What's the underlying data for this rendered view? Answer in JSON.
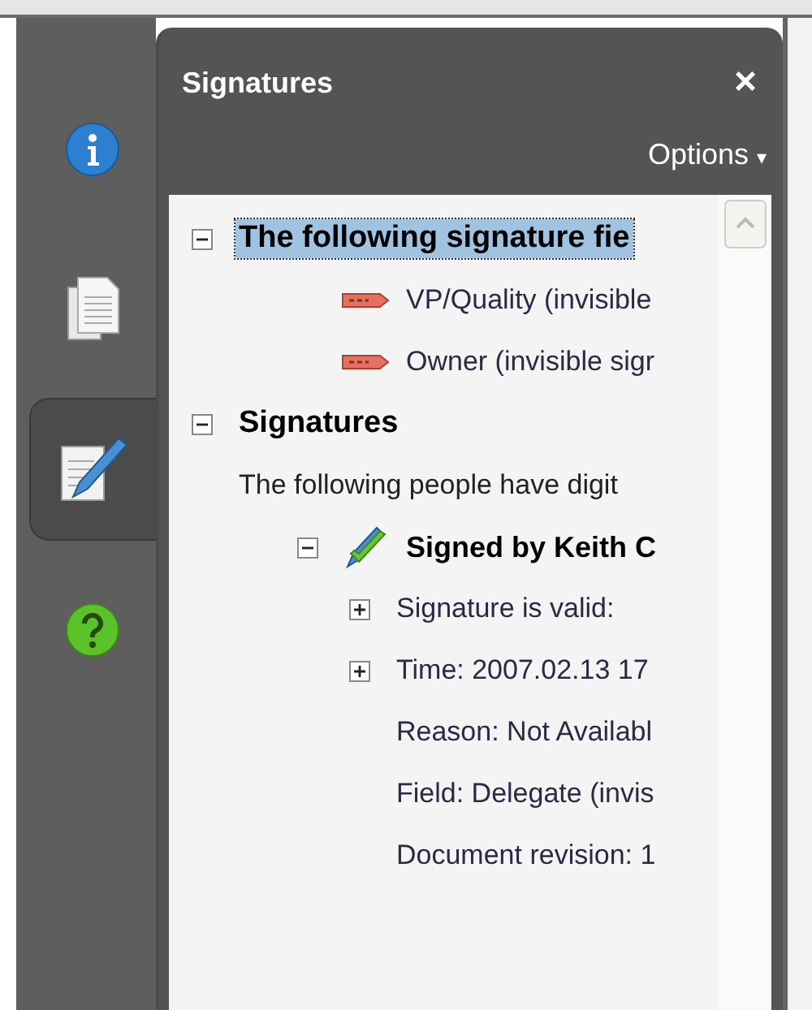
{
  "sidebar": {
    "tabs": [
      {
        "selected": false
      },
      {
        "selected": false
      },
      {
        "selected": true
      },
      {
        "selected": false
      }
    ]
  },
  "panel": {
    "title": "Signatures",
    "close": "×",
    "options": "Options",
    "options_caret": "▾"
  },
  "tree": [
    {
      "kind": "heading",
      "text": "The following signature fie",
      "expanded": true,
      "selected": true,
      "children": [
        {
          "kind": "field",
          "text": "VP/Quality (invisible",
          "selected": false
        },
        {
          "kind": "field",
          "text": "Owner (invisible sigr",
          "selected": false
        }
      ]
    },
    {
      "kind": "heading",
      "text": "Signatures",
      "note": "The following people have digit",
      "expanded": true,
      "selected": false,
      "children": [
        {
          "kind": "signer",
          "text": "Signed by Keith C",
          "expanded": true,
          "selected": false,
          "children": [
            {
              "kind": "detail",
              "text": "Signature is valid:",
              "expanded": false,
              "selected": false
            },
            {
              "kind": "detail",
              "text": "Time: 2007.02.13 17",
              "expanded": false,
              "selected": false
            },
            {
              "kind": "detail",
              "text": "Reason: Not Availabl",
              "selected": false
            },
            {
              "kind": "detail",
              "text": "Field: Delegate (invis",
              "selected": false
            },
            {
              "kind": "detail",
              "text": "Document revision: 1",
              "selected": false
            }
          ]
        }
      ]
    }
  ]
}
